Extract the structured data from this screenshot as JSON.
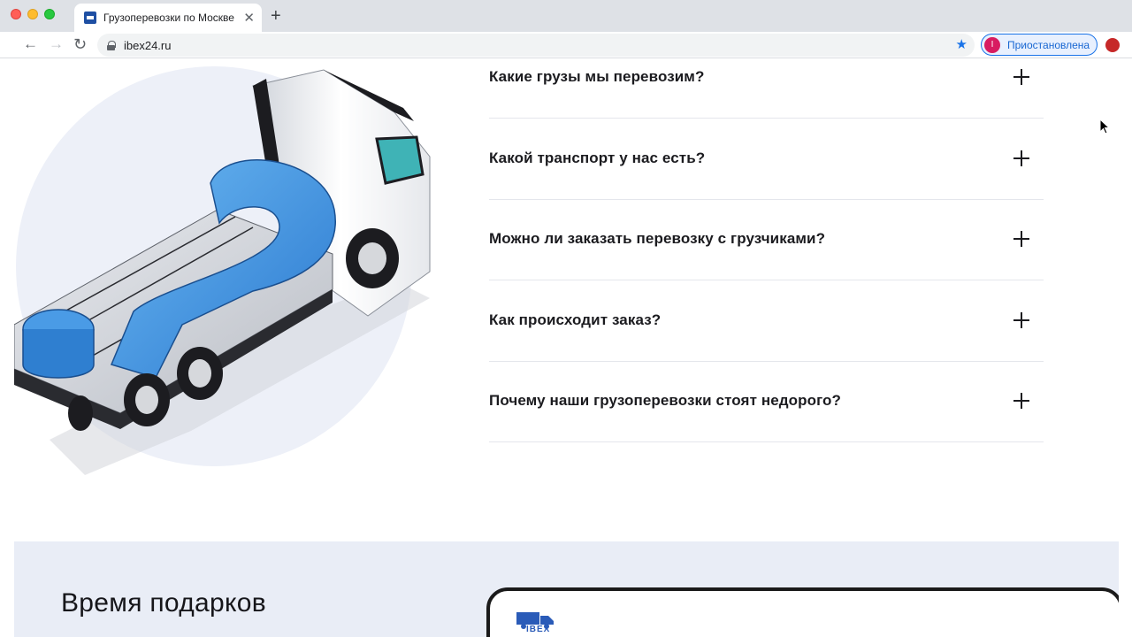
{
  "browser": {
    "tab_title": "Грузоперевозки по Москве и",
    "tab_close_glyph": "✕",
    "new_tab_glyph": "+",
    "url": "ibex24.ru",
    "nav": {
      "back_glyph": "←",
      "forward_glyph": "→",
      "reload_glyph": "↻"
    },
    "bookmark_star_glyph": "★",
    "profile": {
      "initial": "I",
      "status": "Приостановлена"
    },
    "icons": [
      "back-arrow-icon",
      "forward-arrow-icon",
      "reload-icon",
      "lock-icon",
      "bookmark-star-icon",
      "extension-icon"
    ],
    "colors": {
      "accent": "#1a73e8",
      "avatar": "#d81b60"
    }
  },
  "faq": {
    "items": [
      {
        "question": "Какие грузы мы перевозим?"
      },
      {
        "question": "Какой транспорт у нас есть?"
      },
      {
        "question": "Можно ли заказать перевозку с грузчиками?"
      },
      {
        "question": "Как происходит заказ?"
      },
      {
        "question": "Почему наши грузоперевозки стоят недорого?"
      }
    ],
    "toggle_icon": "plus-icon"
  },
  "gifts": {
    "title": "Время подарков",
    "card_logo_text": "IBEX"
  },
  "colors": {
    "question_mark_blue": "#3d8fe0",
    "section_bg": "#e9edf6",
    "hero_circle": "#edf0f8"
  }
}
